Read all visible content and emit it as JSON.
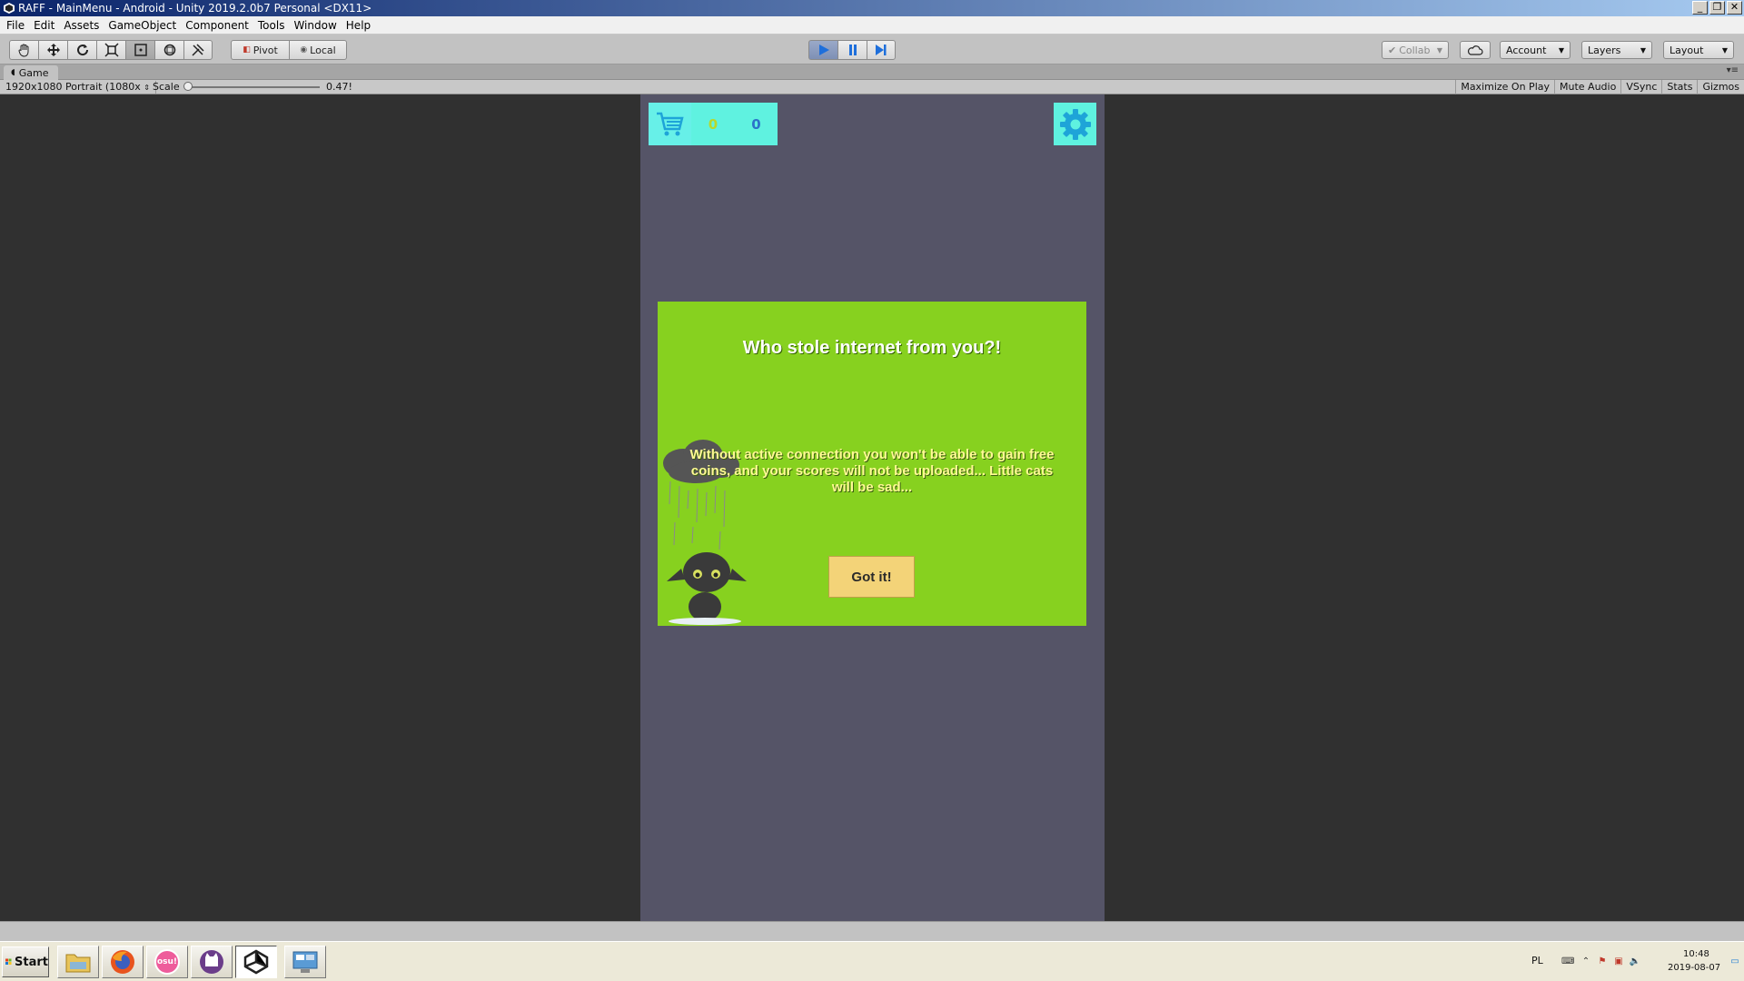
{
  "window": {
    "title": "RAFF - MainMenu - Android - Unity 2019.2.0b7 Personal <DX11>",
    "controls": [
      "_",
      "❐",
      "✕"
    ]
  },
  "menu": [
    "File",
    "Edit",
    "Assets",
    "GameObject",
    "Component",
    "Tools",
    "Window",
    "Help"
  ],
  "toolbar": {
    "pivot_label": "Pivot",
    "local_label": "Local",
    "collab_label": "Collab",
    "account_label": "Account",
    "layers_label": "Layers",
    "layout_label": "Layout"
  },
  "game_tab": {
    "label": "Game"
  },
  "game_bar": {
    "resolution": "1920x1080 Portrait (1080x",
    "scale_label": "Scale",
    "scale_value": "0.47!",
    "scale_slider_fraction": 0.0,
    "options": [
      "Maximize On Play",
      "Mute Audio",
      "VSync",
      "Stats",
      "Gizmos"
    ]
  },
  "game": {
    "coins": "0",
    "gems": "0",
    "dialog_title": "Who stole internet from you?!",
    "dialog_message": "Without active connection you won't be able to gain free coins, and your scores will not be uploaded... Little cats will be sad...",
    "confirm_label": "Got it!"
  },
  "taskbar": {
    "start_label": "Start",
    "apps": [
      "file-explorer",
      "firefox",
      "osu",
      "cat-app",
      "unity",
      "control-panel"
    ],
    "osu_label": "osu!",
    "language": "PL",
    "time": "10:48",
    "date": "2019-08-07"
  },
  "colors": {
    "viewport_bg": "#303030",
    "phone_bg": "#555467",
    "hud_bg": "#5ff2e0",
    "dialog_bg": "#87d11f",
    "button_bg": "#f3d378",
    "play_active": "#7e90b5"
  }
}
